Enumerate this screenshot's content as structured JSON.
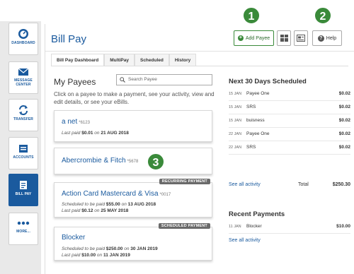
{
  "sidebar": {
    "items": [
      {
        "label": "DASHBOARD",
        "icon": "dashboard-icon"
      },
      {
        "label": "MESSAGE CENTER",
        "icon": "envelope-icon"
      },
      {
        "label": "TRANSFER",
        "icon": "transfer-arrows-icon"
      },
      {
        "label": "ACCOUNTS",
        "icon": "accounts-icon"
      },
      {
        "label": "BILL PAY",
        "icon": "bill-pay-icon"
      },
      {
        "label": "MORE...",
        "icon": "more-dots-icon"
      }
    ],
    "active_index": 4
  },
  "header": {
    "title": "Bill Pay",
    "add_payee_label": "Add Payee",
    "help_label": "Help"
  },
  "callouts": [
    "1",
    "2",
    "3"
  ],
  "tabs": [
    {
      "label": "Bill Pay Dashboard"
    },
    {
      "label": "MultiPay"
    },
    {
      "label": "Scheduled"
    },
    {
      "label": "History"
    }
  ],
  "payees": {
    "title": "My Payees",
    "search_placeholder": "Search Payee",
    "description": "Click on a payee to make a payment, see your activity, view and edit details, or see your eBills.",
    "cards": [
      {
        "name": "a net",
        "account": "*6123",
        "line1": {
          "prefix": "Last paid",
          "amount": "$0.01",
          "on": "on",
          "date": "21 AUG 2018"
        }
      },
      {
        "name": "Abercrombie & Fitch",
        "account": "*5678"
      },
      {
        "name": "Action Card Mastercard & Visa",
        "account": "*0017",
        "badge": "RECURRING PAYMENT",
        "line1": {
          "prefix": "Scheduled to be paid",
          "amount": "$55.00",
          "on": "on",
          "date": "13 AUG 2018"
        },
        "line2": {
          "prefix": "Last paid",
          "amount": "$0.12",
          "on": "on",
          "date": "25 MAY 2018"
        }
      },
      {
        "name": "Blocker",
        "account": "",
        "badge": "SCHEDULED PAYMENT",
        "line1": {
          "prefix": "Scheduled to be paid",
          "amount": "$250.00",
          "on": "on",
          "date": "30 JAN 2019"
        },
        "line2": {
          "prefix": "Last paid",
          "amount": "$10.00",
          "on": "on",
          "date": "11 JAN 2019"
        }
      }
    ]
  },
  "scheduled": {
    "title": "Next 30 Days Scheduled",
    "rows": [
      {
        "date": "15 JAN",
        "payee": "Payee One",
        "amount": "$0.02"
      },
      {
        "date": "15 JAN",
        "payee": "SRS",
        "amount": "$0.02"
      },
      {
        "date": "15 JAN",
        "payee": "buisness",
        "amount": "$0.02"
      },
      {
        "date": "22 JAN",
        "payee": "Payee One",
        "amount": "$0.02"
      },
      {
        "date": "22 JAN",
        "payee": "SRS",
        "amount": "$0.02"
      }
    ],
    "see_all": "See all activity",
    "total_label": "Total",
    "total_value": "$250.30"
  },
  "recent": {
    "title": "Recent Payments",
    "rows": [
      {
        "date": "11 JAN",
        "payee": "Blocker",
        "amount": "$10.00"
      }
    ],
    "see_all": "See all activity"
  },
  "colors": {
    "brand_blue": "#1a5a9e",
    "accent_green": "#3a8a3a",
    "badge_gray": "#6a6a6a"
  }
}
